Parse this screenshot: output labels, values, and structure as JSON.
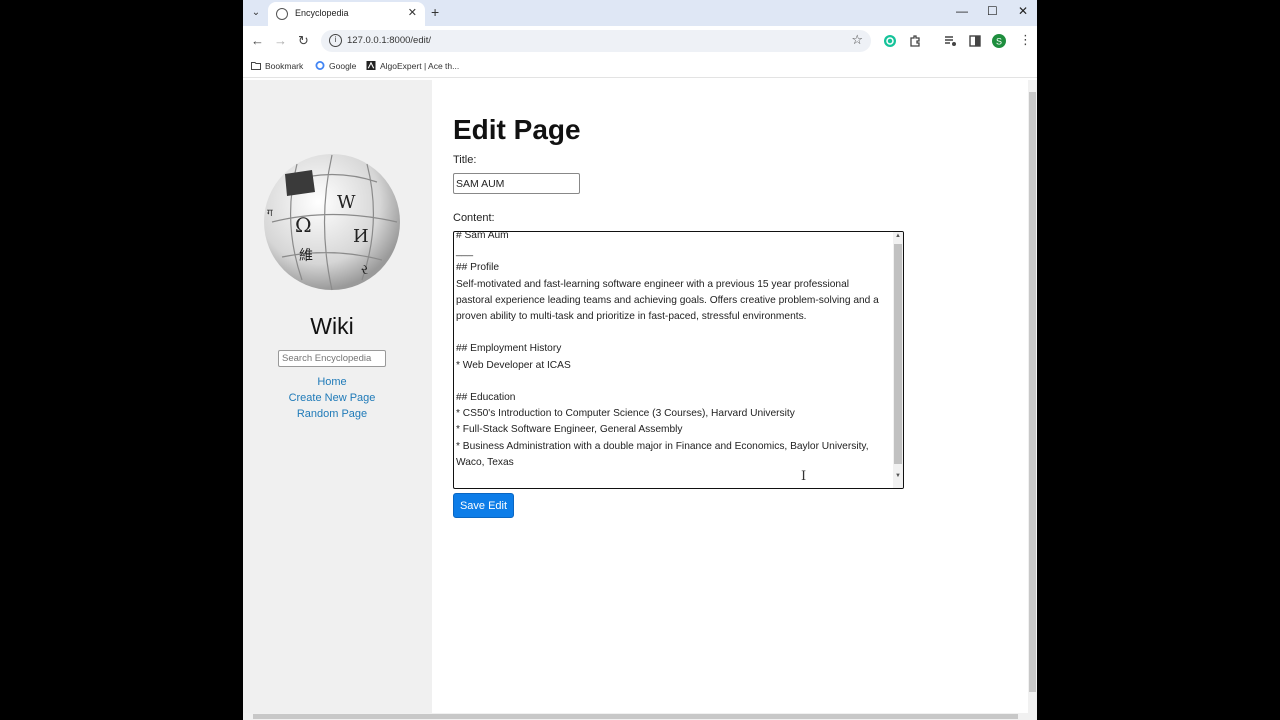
{
  "browser": {
    "tab_title": "Encyclopedia",
    "url": "127.0.0.1:8000/edit/",
    "bookmarks": [
      "Bookmark",
      "Google",
      "AlgoExpert | Ace th..."
    ],
    "profile_initial": "S"
  },
  "sidebar": {
    "title": "Wiki",
    "search_placeholder": "Search Encyclopedia",
    "links": [
      "Home",
      "Create New Page",
      "Random Page"
    ]
  },
  "main": {
    "heading": "Edit Page",
    "title_label": "Title:",
    "title_value": "SAM AUM",
    "content_label": "Content:",
    "content_value": "# Sam Aum\n___\n## Profile\nSelf-motivated and fast-learning software engineer with a previous 15 year professional pastoral experience leading teams and achieving goals. Offers creative problem-solving and a proven ability to multi-task and prioritize in fast-paced, stressful environments.\n\n## Employment History\n* Web Developer at ICAS\n\n## Education\n* CS50's Introduction to Computer Science (3 Courses), Harvard University\n* Full-Stack Software Engineer, General Assembly\n* Business Administration with a double major in Finance and Economics, Baylor University, Waco, Texas\n",
    "save_label": "Save Edit"
  },
  "colors": {
    "accent": "#0d7de8",
    "link": "#1f7ab8",
    "sidebar_bg": "#f0f0f0"
  }
}
